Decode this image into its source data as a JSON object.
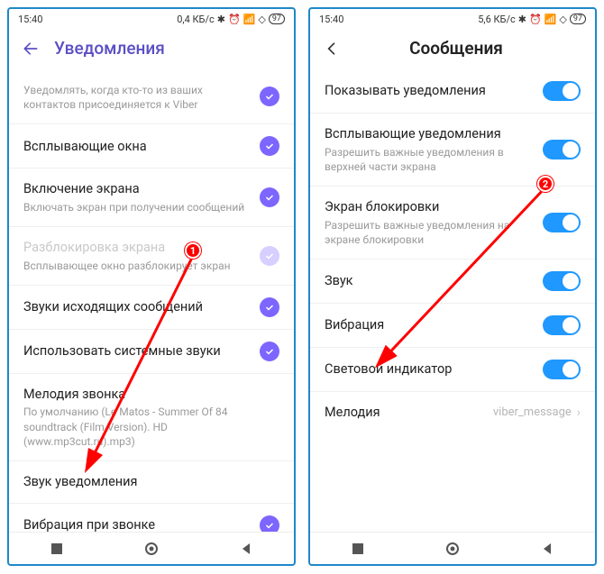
{
  "left": {
    "status": {
      "time": "15:40",
      "net": "0,4 КБ/с",
      "batt": "97"
    },
    "header": {
      "title": "Уведомления"
    },
    "rows": {
      "r0": {
        "sub": "Уведомлять, когда кто-то из ваших контактов присоединяется к Viber"
      },
      "r1": {
        "title": "Всплывающие окна"
      },
      "r2": {
        "title": "Включение экрана",
        "sub": "Включать экран при получении сообщений"
      },
      "r3": {
        "title": "Разблокировка экрана",
        "sub": "Всплывающее окно разблокирует экран"
      },
      "r4": {
        "title": "Звуки исходящих сообщений"
      },
      "r5": {
        "title": "Использовать системные звуки"
      },
      "r6": {
        "title": "Мелодия звонка",
        "sub": "По умолчанию (Le Matos - Summer Of 84 soundtrack (Film Version). HD (www.mp3cut.ru).mp3)"
      },
      "r7": {
        "title": "Звук уведомления"
      },
      "r8": {
        "title": "Вибрация при звонке"
      }
    },
    "marker": "1"
  },
  "right": {
    "status": {
      "time": "15:40",
      "net": "5,6 КБ/с",
      "batt": "97"
    },
    "header": {
      "title": "Сообщения"
    },
    "rows": {
      "r0": {
        "title": "Показывать уведомления"
      },
      "r1": {
        "title": "Всплывающие уведомления",
        "sub": "Разрешить важные уведомления в верхней части экрана"
      },
      "r2": {
        "title": "Экран блокировки",
        "sub": "Разрешить важные уведомления на экране блокировки"
      },
      "r3": {
        "title": "Звук"
      },
      "r4": {
        "title": "Вибрация"
      },
      "r5": {
        "title": "Световой индикатор"
      },
      "r6": {
        "title": "Мелодия",
        "value": "viber_message"
      }
    },
    "marker": "2"
  }
}
